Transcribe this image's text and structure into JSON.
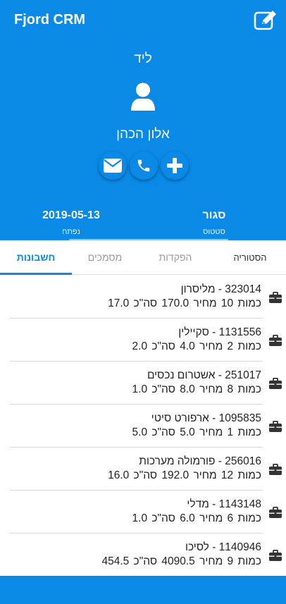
{
  "app": {
    "title": "Fjord CRM"
  },
  "hero": {
    "type_label": "ליד",
    "contact_name": "אלון הכהן",
    "date_value": "2019-05-13",
    "date_label": "נפתח",
    "status_value": "סגור",
    "status_label": "סטטוס"
  },
  "tabs": {
    "history": "הסטוריה",
    "orders": "הפקדות",
    "documents": "מסמכים",
    "accounts": "חשבונות",
    "active": "accounts"
  },
  "accounts": [
    {
      "title": "323014 - מליסרון",
      "detail": "כמות 10   מחיר 170.0   סה\"כ 17.0"
    },
    {
      "title": "1131556 - סקיילין",
      "detail": "כמות 2   מחיר 4.0   סה\"כ 2.0"
    },
    {
      "title": "251017 - אשטרום נכסים",
      "detail": "כמות 8   מחיר 8.0   סה\"כ 1.0"
    },
    {
      "title": "1095835 - ארפורט סיטי",
      "detail": "כמות 1   מחיר 5.0   סה\"כ 5.0"
    },
    {
      "title": "256016 - פורמולה מערכות",
      "detail": "כמות 12   מחיר 192.0   סה\"כ 16.0"
    },
    {
      "title": "1143148 - מדלי",
      "detail": "כמות 6   מחיר 6.0   סה\"כ 1.0"
    },
    {
      "title": "1140946 - לסיכו",
      "detail": "כמות 9   מחיר 4090.5   סה\"כ 454.5"
    }
  ],
  "colors": {
    "primary": "#0a8ae6",
    "divider": "#d8d8d8",
    "inactive_tab": "#9a9a9a"
  },
  "icons": {
    "edit": "edit-icon",
    "avatar": "user-icon",
    "email": "envelope-icon",
    "phone": "phone-icon",
    "add": "plus-icon",
    "account": "briefcase-icon"
  }
}
